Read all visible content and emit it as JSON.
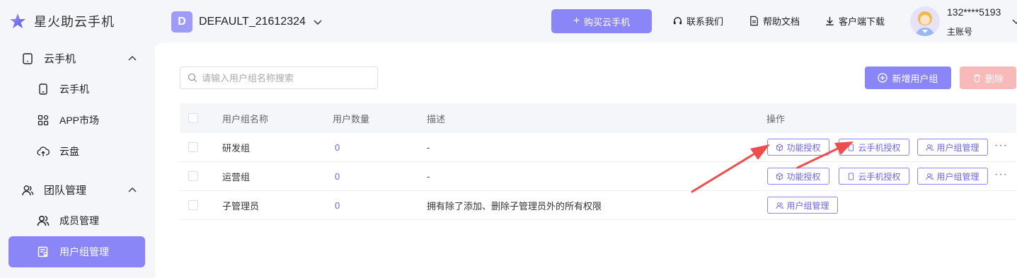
{
  "header": {
    "brand": "星火助云手机",
    "workspace_badge": "D",
    "workspace_name": "DEFAULT_21612324",
    "buy_button": "购买云手机",
    "links": [
      "联系我们",
      "帮助文档",
      "客户端下载"
    ],
    "user_phone": "132****5193",
    "user_role": "主账号"
  },
  "sidebar": {
    "groups": [
      {
        "label": "云手机",
        "items": [
          "云手机",
          "APP市场",
          "云盘"
        ]
      },
      {
        "label": "团队管理",
        "items": [
          "成员管理",
          "用户组管理"
        ]
      }
    ],
    "active_item": "用户组管理"
  },
  "main": {
    "search_placeholder": "请输入用户组名称搜索",
    "add_button": "新增用户组",
    "delete_button": "删除",
    "table": {
      "columns": [
        "用户组名称",
        "用户数量",
        "描述",
        "操作"
      ],
      "rows": [
        {
          "name": "研发组",
          "count": "0",
          "desc": "-",
          "ops": [
            "功能授权",
            "云手机授权",
            "用户组管理"
          ],
          "more": "···"
        },
        {
          "name": "运营组",
          "count": "0",
          "desc": "-",
          "ops": [
            "功能授权",
            "云手机授权",
            "用户组管理"
          ],
          "more": "···"
        },
        {
          "name": "子管理员",
          "count": "0",
          "desc": "拥有除了添加、删除子管理员外的所有权限",
          "ops": [
            "用户组管理"
          ]
        }
      ]
    }
  },
  "colors": {
    "accent": "#8b86f7",
    "accent_text": "#6b66e8",
    "danger_disabled": "#f8b9b9",
    "arrow": "#ee4d4d"
  }
}
